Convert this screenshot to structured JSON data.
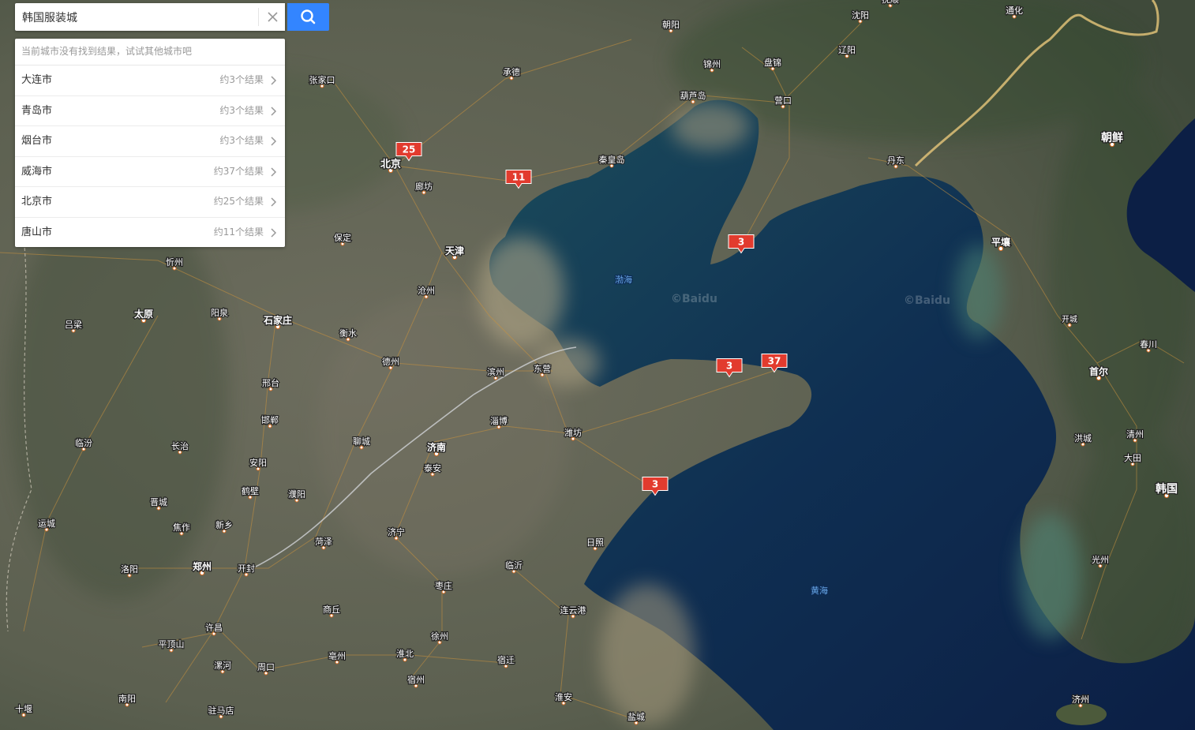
{
  "search": {
    "query": "韩国服装城",
    "clear_icon": "close-icon",
    "search_icon": "search-icon"
  },
  "results": {
    "notice": "当前城市没有找到结果，试试其他城市吧",
    "items": [
      {
        "city": "大连市",
        "count": "约3个结果"
      },
      {
        "city": "青岛市",
        "count": "约3个结果"
      },
      {
        "city": "烟台市",
        "count": "约3个结果"
      },
      {
        "city": "威海市",
        "count": "约37个结果"
      },
      {
        "city": "北京市",
        "count": "约25个结果"
      },
      {
        "city": "唐山市",
        "count": "约11个结果"
      }
    ]
  },
  "markers": [
    {
      "count": "25"
    },
    {
      "count": "11"
    },
    {
      "count": "3"
    },
    {
      "count": "3"
    },
    {
      "count": "37"
    },
    {
      "count": "3"
    }
  ],
  "city_labels": [
    "北京",
    "天津",
    "石家庄",
    "太原",
    "朝阳",
    "沈阳",
    "辽阳",
    "锦州",
    "盘锦",
    "营口",
    "葫芦岛",
    "秦皇岛",
    "承德",
    "张家口",
    "廊坊",
    "保定",
    "沧州",
    "衡水",
    "德州",
    "忻州",
    "阳泉",
    "吕梁",
    "邢台",
    "邯郸",
    "长治",
    "临汾",
    "运城",
    "晋城",
    "安阳",
    "鹤壁",
    "濮阳",
    "新乡",
    "焦作",
    "洛阳",
    "郑州",
    "开封",
    "菏泽",
    "济宁",
    "聊城",
    "济南",
    "泰安",
    "淄博",
    "滨州",
    "东营",
    "潍坊",
    "日照",
    "临沂",
    "枣庄",
    "商丘",
    "许昌",
    "平顶山",
    "漯河",
    "周口",
    "亳州",
    "淮北",
    "宿州",
    "徐州",
    "宿迁",
    "连云港",
    "淮安",
    "盐城",
    "南阳",
    "驻马店",
    "十堰",
    "丹东",
    "平壤",
    "首尔",
    "朝鲜",
    "韩国",
    "开城",
    "春川",
    "洪城",
    "清州",
    "大田",
    "光州",
    "济州",
    "通化",
    "抚顺"
  ],
  "sea_labels": [
    "渤海",
    "黄海"
  ],
  "watermark": "©Baidu",
  "colors": {
    "search_button": "#3385ff",
    "marker": "#e23b2e"
  }
}
